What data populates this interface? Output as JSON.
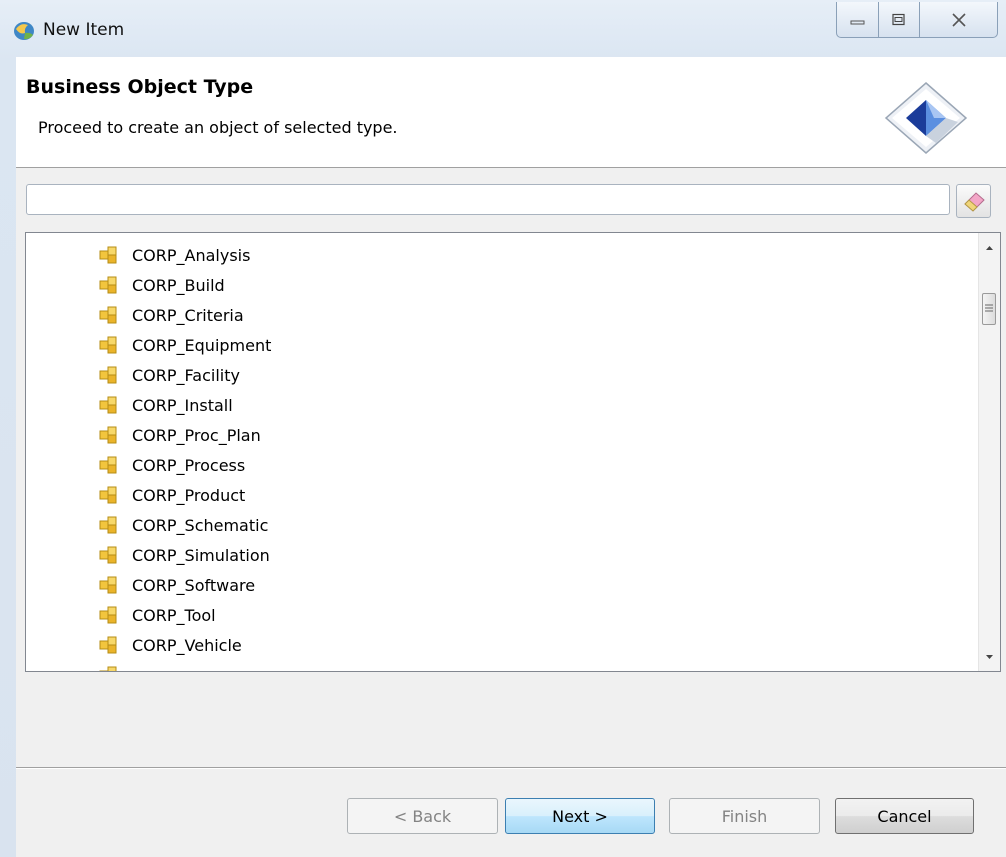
{
  "window": {
    "title": "New Item"
  },
  "header": {
    "title": "Business Object Type",
    "description": "Proceed to create an object of selected type."
  },
  "filter": {
    "value": "",
    "placeholder": ""
  },
  "tree": {
    "items": [
      {
        "label": "CORP_Analysis",
        "icon": "business-object-icon"
      },
      {
        "label": "CORP_Build",
        "icon": "business-object-icon"
      },
      {
        "label": "CORP_Criteria",
        "icon": "business-object-icon"
      },
      {
        "label": "CORP_Equipment",
        "icon": "business-object-icon"
      },
      {
        "label": "CORP_Facility",
        "icon": "business-object-icon"
      },
      {
        "label": "CORP_Install",
        "icon": "business-object-icon"
      },
      {
        "label": "CORP_Proc_Plan",
        "icon": "business-object-icon"
      },
      {
        "label": "CORP_Process",
        "icon": "business-object-icon"
      },
      {
        "label": "CORP_Product",
        "icon": "business-object-icon"
      },
      {
        "label": "CORP_Schematic",
        "icon": "business-object-icon"
      },
      {
        "label": "CORP_Simulation",
        "icon": "business-object-icon"
      },
      {
        "label": "CORP_Software",
        "icon": "business-object-icon"
      },
      {
        "label": "CORP_Tool",
        "icon": "business-object-icon"
      },
      {
        "label": "CORP_Vehicle",
        "icon": "business-object-icon"
      }
    ]
  },
  "buttons": {
    "back": "< Back",
    "next": "Next >",
    "finish": "Finish",
    "cancel": "Cancel"
  },
  "colors": {
    "accent": "#3c7fb1",
    "icon_yellow": "#f2c53d"
  }
}
